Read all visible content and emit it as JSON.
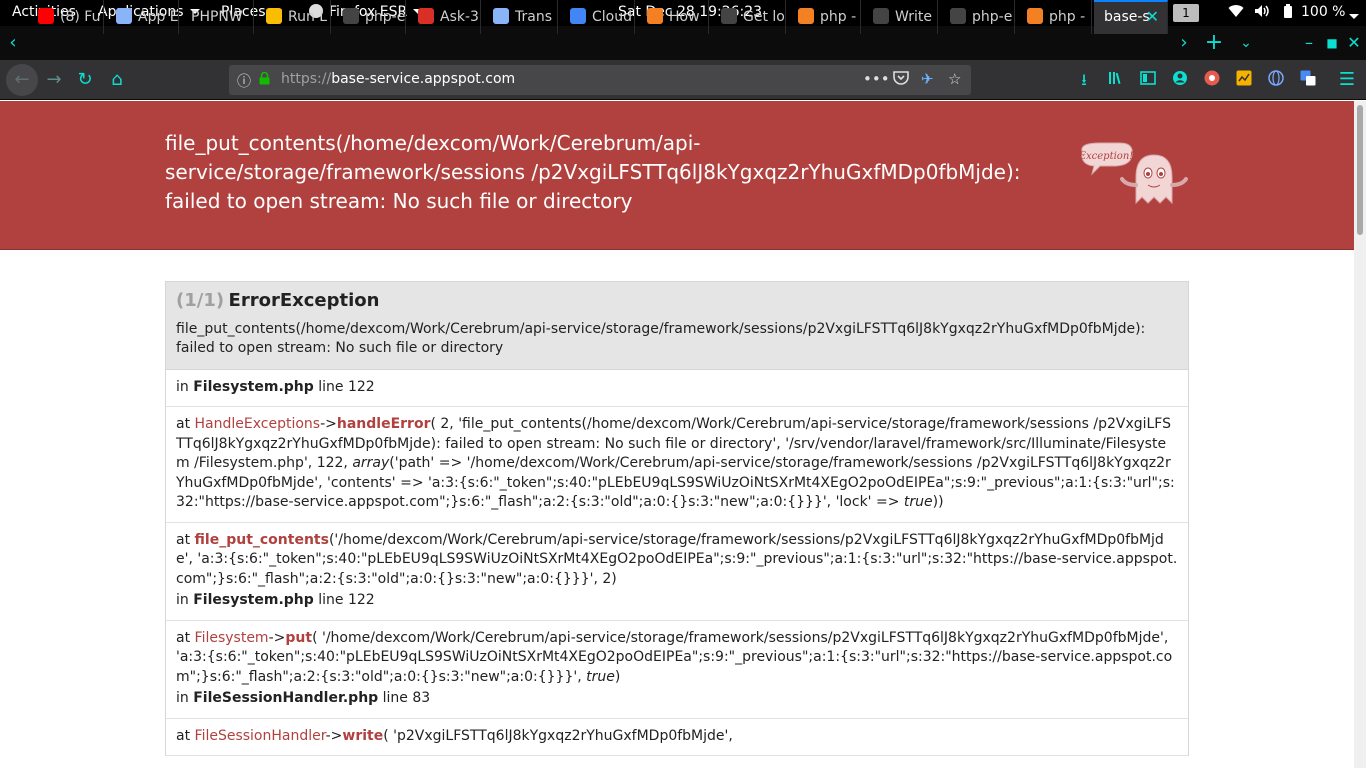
{
  "topbar": {
    "activities": "Activities",
    "applications": "Applications",
    "places": "Places",
    "firefox": "Firefox ESR",
    "clock": "Sat Dec 28  19:26:23",
    "workspace": "1",
    "battery": "100 %"
  },
  "tabs": [
    {
      "label": "(8) Fu",
      "fav_color": "#ff0000"
    },
    {
      "label": "App E",
      "fav_color": "#8ab4f8"
    },
    {
      "label": "PHPNW",
      "fav_color": ""
    },
    {
      "label": "Run L",
      "fav_color": "#fbbc04"
    },
    {
      "label": "php-e",
      "fav_color": "#444"
    },
    {
      "label": "Ask-3",
      "fav_color": "#d93025"
    },
    {
      "label": "Trans",
      "fav_color": "#8ab4f8"
    },
    {
      "label": "Cloud",
      "fav_color": "#4285f4"
    },
    {
      "label": "How",
      "fav_color": "#f48024"
    },
    {
      "label": "Get lo",
      "fav_color": "#444"
    },
    {
      "label": "php -",
      "fav_color": "#f48024"
    },
    {
      "label": "Write",
      "fav_color": "#444"
    },
    {
      "label": "php-e",
      "fav_color": "#444"
    },
    {
      "label": "php -",
      "fav_color": "#f48024"
    },
    {
      "label": "base-s",
      "fav_color": ""
    }
  ],
  "urlbar": {
    "scheme": "https://",
    "host": "base-service.appspot.com"
  },
  "page": {
    "header_title": "file_put_contents(/home/dexcom/Work/Cerebrum/api-service/storage/framework/sessions /p2VxgiLFSTTq6lJ8kYgxqz2rYhuGxfMDp0fbMjde): failed to open stream: No such file or directory",
    "ghost_text": "Exception!",
    "count": "(1/1)",
    "exception_class": "ErrorException",
    "message": "file_put_contents(/home/dexcom/Work/Cerebrum/api-service/storage/framework/sessions/p2VxgiLFSTTq6lJ8kYgxqz2rYhuGxfMDp0fbMjde): failed to open stream: No such file or directory",
    "first_in": {
      "prefix": "in",
      "file": "Filesystem.php",
      "line": "line 122"
    },
    "frames": [
      {
        "at": "at",
        "cls": "HandleExceptions",
        "arrow": "->",
        "fn": "handleError",
        "args_a": "( 2, 'file_put_contents(/home/dexcom/Work/Cerebrum/api-service/storage/framework/sessions /p2VxgiLFSTTq6lJ8kYgxqz2rYhuGxfMDp0fbMjde): failed to open stream: No such file or directory', '/srv/vendor/laravel/framework/src/Illuminate/Filesystem /Filesystem.php', 122, ",
        "args_it": "array",
        "args_b": "('path' => '/home/dexcom/Work/Cerebrum/api-service/storage/framework/sessions /p2VxgiLFSTTq6lJ8kYgxqz2rYhuGxfMDp0fbMjde', 'contents' => 'a:3:{s:6:\"_token\";s:40:\"pLEbEU9qLS9SWiUzOiNtSXrMt4XEgO2poOdEIPEa\";s:9:\"_previous\";a:1:{s:3:\"url\";s:32:\"https://base-service.appspot.com\";}s:6:\"_flash\";a:2:{s:3:\"old\";a:0:{}s:3:\"new\";a:0:{}}}', 'lock' => ",
        "args_it2": "true",
        "args_c": "))"
      },
      {
        "at": "at",
        "fn": "file_put_contents",
        "args_a": "('/home/dexcom/Work/Cerebrum/api-service/storage/framework/sessions/p2VxgiLFSTTq6lJ8kYgxqz2rYhuGxfMDp0fbMjde', 'a:3:{s:6:\"_token\";s:40:\"pLEbEU9qLS9SWiUzOiNtSXrMt4XEgO2poOdEIPEa\";s:9:\"_previous\";a:1:{s:3:\"url\";s:32:\"https://base-service.appspot.com\";}s:6:\"_flash\";a:2:{s:3:\"old\";a:0:{}s:3:\"new\";a:0:{}}}', 2)",
        "in_prefix": "in",
        "in_file": "Filesystem.php",
        "in_line": "line 122"
      },
      {
        "at": "at",
        "cls": "Filesystem",
        "arrow": "->",
        "fn": "put",
        "args_a": "( '/home/dexcom/Work/Cerebrum/api-service/storage/framework/sessions/p2VxgiLFSTTq6lJ8kYgxqz2rYhuGxfMDp0fbMjde', 'a:3:{s:6:\"_token\";s:40:\"pLEbEU9qLS9SWiUzOiNtSXrMt4XEgO2poOdEIPEa\";s:9:\"_previous\";a:1:{s:3:\"url\";s:32:\"https://base-service.appspot.com\";}s:6:\"_flash\";a:2:{s:3:\"old\";a:0:{}s:3:\"new\";a:0:{}}}', ",
        "args_it": "true",
        "args_c": ")",
        "in_prefix": "in",
        "in_file": "FileSessionHandler.php",
        "in_line": "line 83"
      },
      {
        "at": "at",
        "cls": "FileSessionHandler",
        "arrow": "->",
        "fn": "write",
        "args_a": "( 'p2VxgiLFSTTq6lJ8kYgxqz2rYhuGxfMDp0fbMjde',"
      }
    ]
  }
}
